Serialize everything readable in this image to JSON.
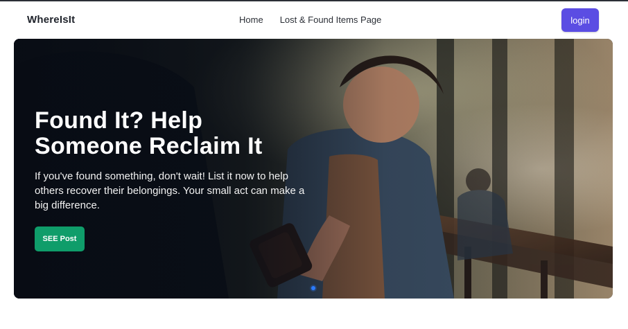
{
  "navbar": {
    "brand": "WhereIsIt",
    "links": [
      {
        "label": "Home"
      },
      {
        "label": "Lost & Found Items Page"
      }
    ],
    "login_label": "login"
  },
  "hero": {
    "title_line1": "Found It? Help",
    "title_line2": "Someone Reclaim It",
    "subtitle": "If you've found something, don't wait! List it now to help others recover their belongings. Your small act can make a big difference.",
    "button_label": "SEE Post"
  },
  "colors": {
    "brand_text": "#20242c",
    "login_bg": "#5b4de3",
    "cta_bg": "#0f9d6a",
    "carousel_active": "#2b7cff"
  }
}
